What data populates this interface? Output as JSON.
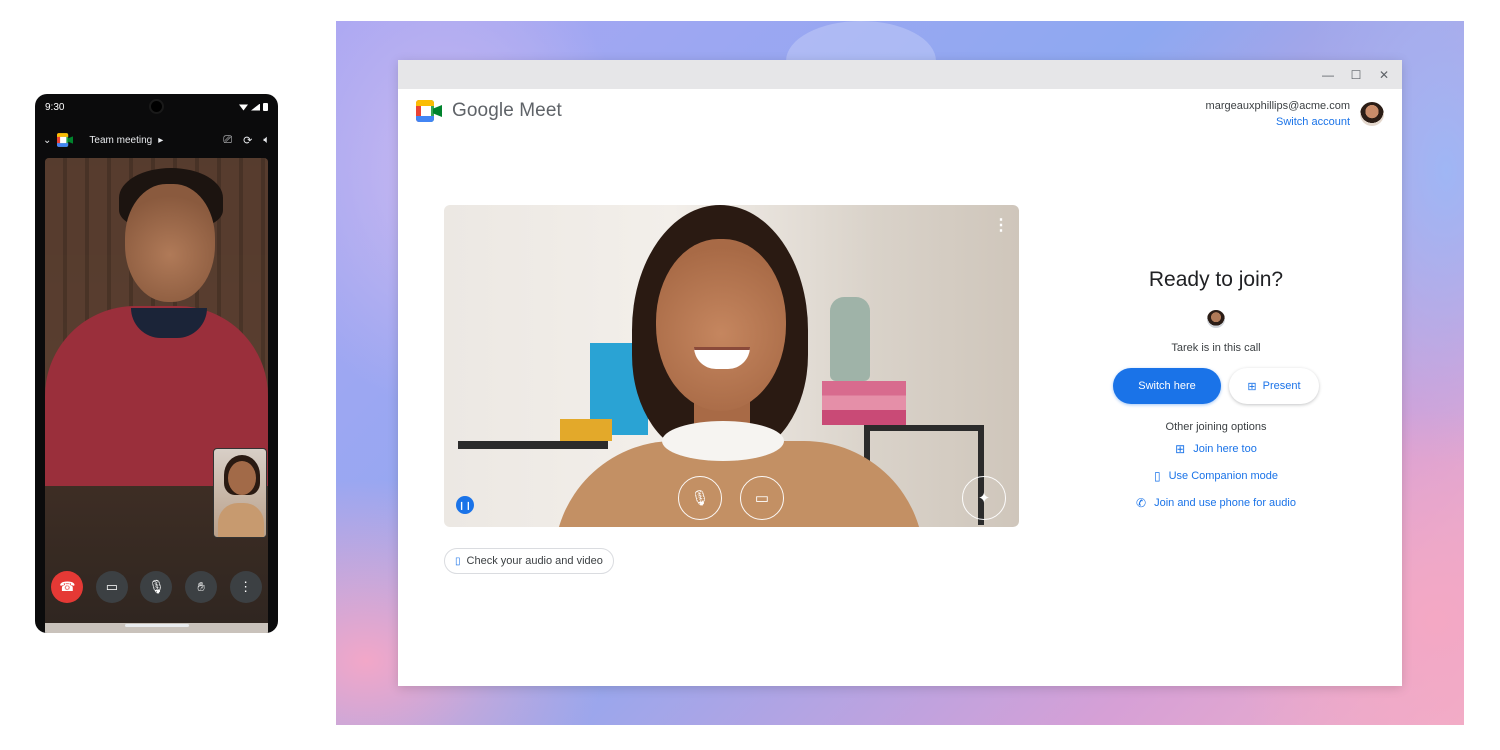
{
  "phone": {
    "time": "9:30",
    "meeting_title": "Team meeting"
  },
  "meet": {
    "app_name": "Google Meet",
    "account_email": "margeauxphillips@acme.com",
    "switch_account": "Switch account",
    "ready_heading": "Ready to join?",
    "in_call_text": "Tarek is in this call",
    "switch_here": "Switch here",
    "present": "Present",
    "other_options_heading": "Other joining options",
    "options": [
      "Join here too",
      "Use Companion mode",
      "Join and use phone for audio"
    ],
    "check_av": "Check your audio and video"
  },
  "colors": {
    "accent": "#1a73e8",
    "end_call": "#e53935"
  }
}
